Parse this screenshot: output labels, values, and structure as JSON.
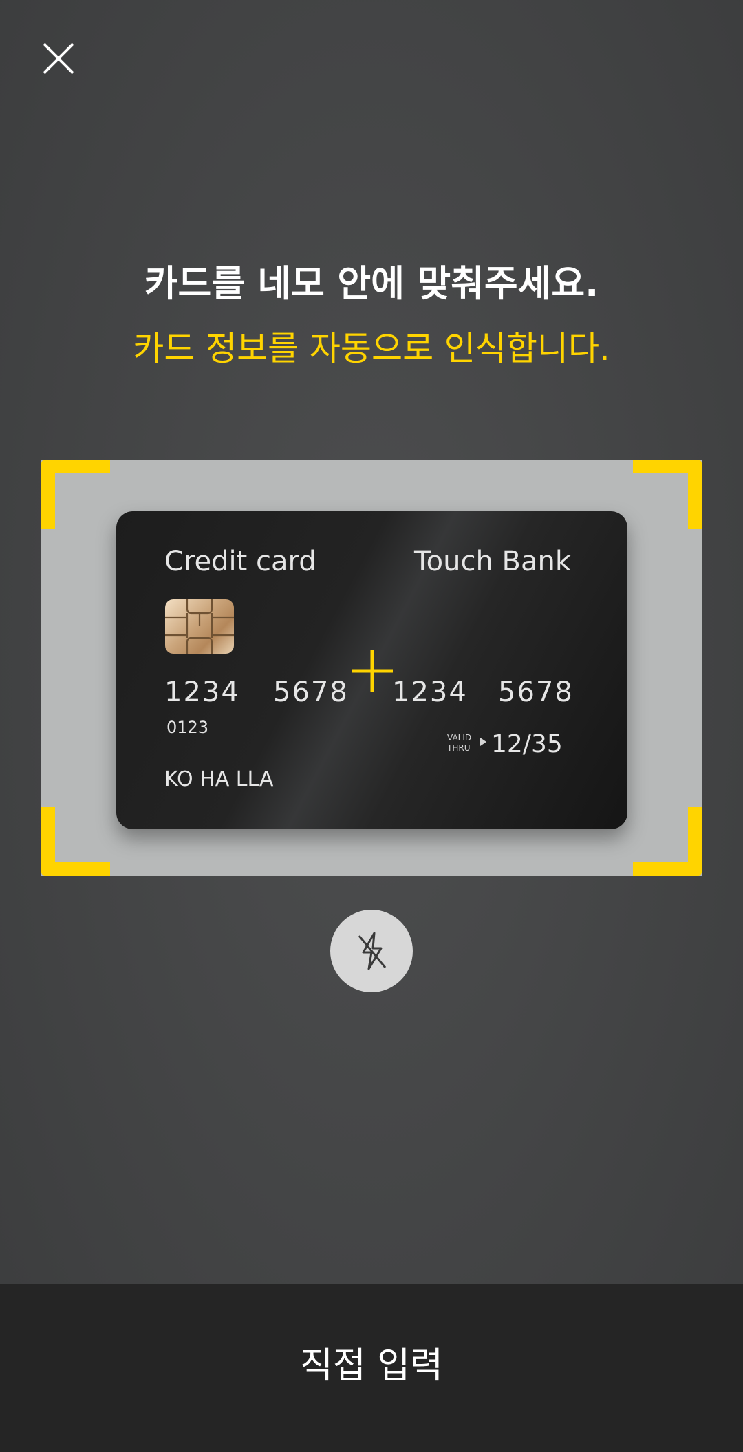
{
  "close": {
    "icon": "close-icon"
  },
  "heading": "카드를 네모 안에 맞춰주세요.",
  "subheading": "카드 정보를 자동으로 인식합니다.",
  "colors": {
    "accent": "#ffd400",
    "frame": "#b7b9b9",
    "bottom_bar": "#252525"
  },
  "card": {
    "title": "Credit card",
    "bank": "Touch Bank",
    "numbers": [
      "1234",
      "5678",
      "1234",
      "5678"
    ],
    "small_number": "0123",
    "valid_label_1": "VALID",
    "valid_label_2": "THRU",
    "valid_date": "12/35",
    "holder": "KO HA LLA"
  },
  "flash": {
    "icon": "flash-off-icon"
  },
  "bottom": {
    "manual_input_label": "직접 입력"
  }
}
